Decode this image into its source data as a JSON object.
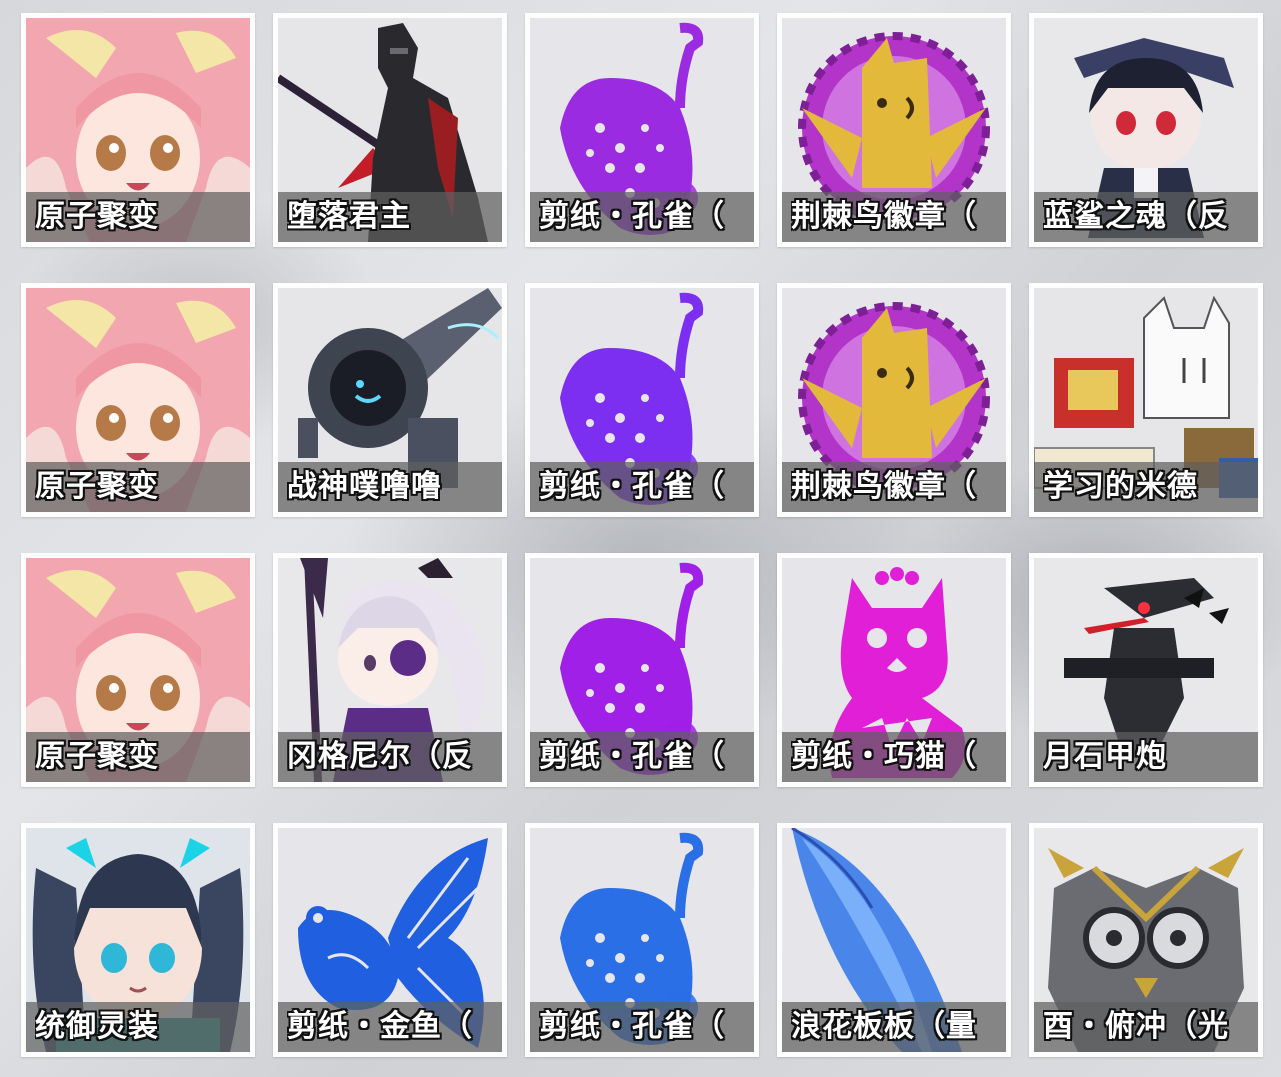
{
  "items": [
    {
      "label": "原子聚变",
      "icon": "pink-hair-girl-portrait-icon",
      "color": "#f2a7b0"
    },
    {
      "label": "堕落君主",
      "icon": "dark-knight-icon",
      "color": "#2a2a2e"
    },
    {
      "label": "剪纸・孔雀（",
      "icon": "papercut-peacock-icon",
      "color": "#9b2be0"
    },
    {
      "label": "荆棘鸟徽章（",
      "icon": "thorn-bird-badge-icon",
      "color": "#e2b93b"
    },
    {
      "label": "蓝鲨之魂（反",
      "icon": "blue-shark-chibi-icon",
      "color": "#3a3f66"
    },
    {
      "label": "原子聚变",
      "icon": "pink-hair-girl-portrait-icon",
      "color": "#f2a7b0"
    },
    {
      "label": "战神噗噜噜",
      "icon": "mech-robot-icon",
      "color": "#3e4450"
    },
    {
      "label": "剪纸・孔雀（",
      "icon": "papercut-peacock-icon",
      "color": "#7c2ff0"
    },
    {
      "label": "荆棘鸟徽章（",
      "icon": "thorn-bird-badge-icon",
      "color": "#e2b93b"
    },
    {
      "label": "学习的米德",
      "icon": "book-cat-icon",
      "color": "#c9302c"
    },
    {
      "label": "原子聚变",
      "icon": "pink-hair-girl-portrait-icon",
      "color": "#f2a7b0"
    },
    {
      "label": "冈格尼尔（反",
      "icon": "white-hair-chibi-icon",
      "color": "#5b2d86"
    },
    {
      "label": "剪纸・孔雀（",
      "icon": "papercut-peacock-icon",
      "color": "#a020e8"
    },
    {
      "label": "剪纸・巧猫（",
      "icon": "papercut-cat-icon",
      "color": "#e01fd6"
    },
    {
      "label": "月石甲炮",
      "icon": "moonstone-cannon-icon",
      "color": "#2b2d33"
    },
    {
      "label": "统御灵装",
      "icon": "twin-tail-girl-portrait-icon",
      "color": "#1ad3e6"
    },
    {
      "label": "剪纸・金鱼（",
      "icon": "papercut-goldfish-icon",
      "color": "#1f5fe0"
    },
    {
      "label": "剪纸・孔雀（",
      "icon": "papercut-peacock-icon",
      "color": "#2a6fe6"
    },
    {
      "label": "浪花板板（量",
      "icon": "blue-surfboard-icon",
      "color": "#4a86ea"
    },
    {
      "label": "酉・俯冲（光",
      "icon": "armored-owl-mech-icon",
      "color": "#c8a43a"
    }
  ]
}
